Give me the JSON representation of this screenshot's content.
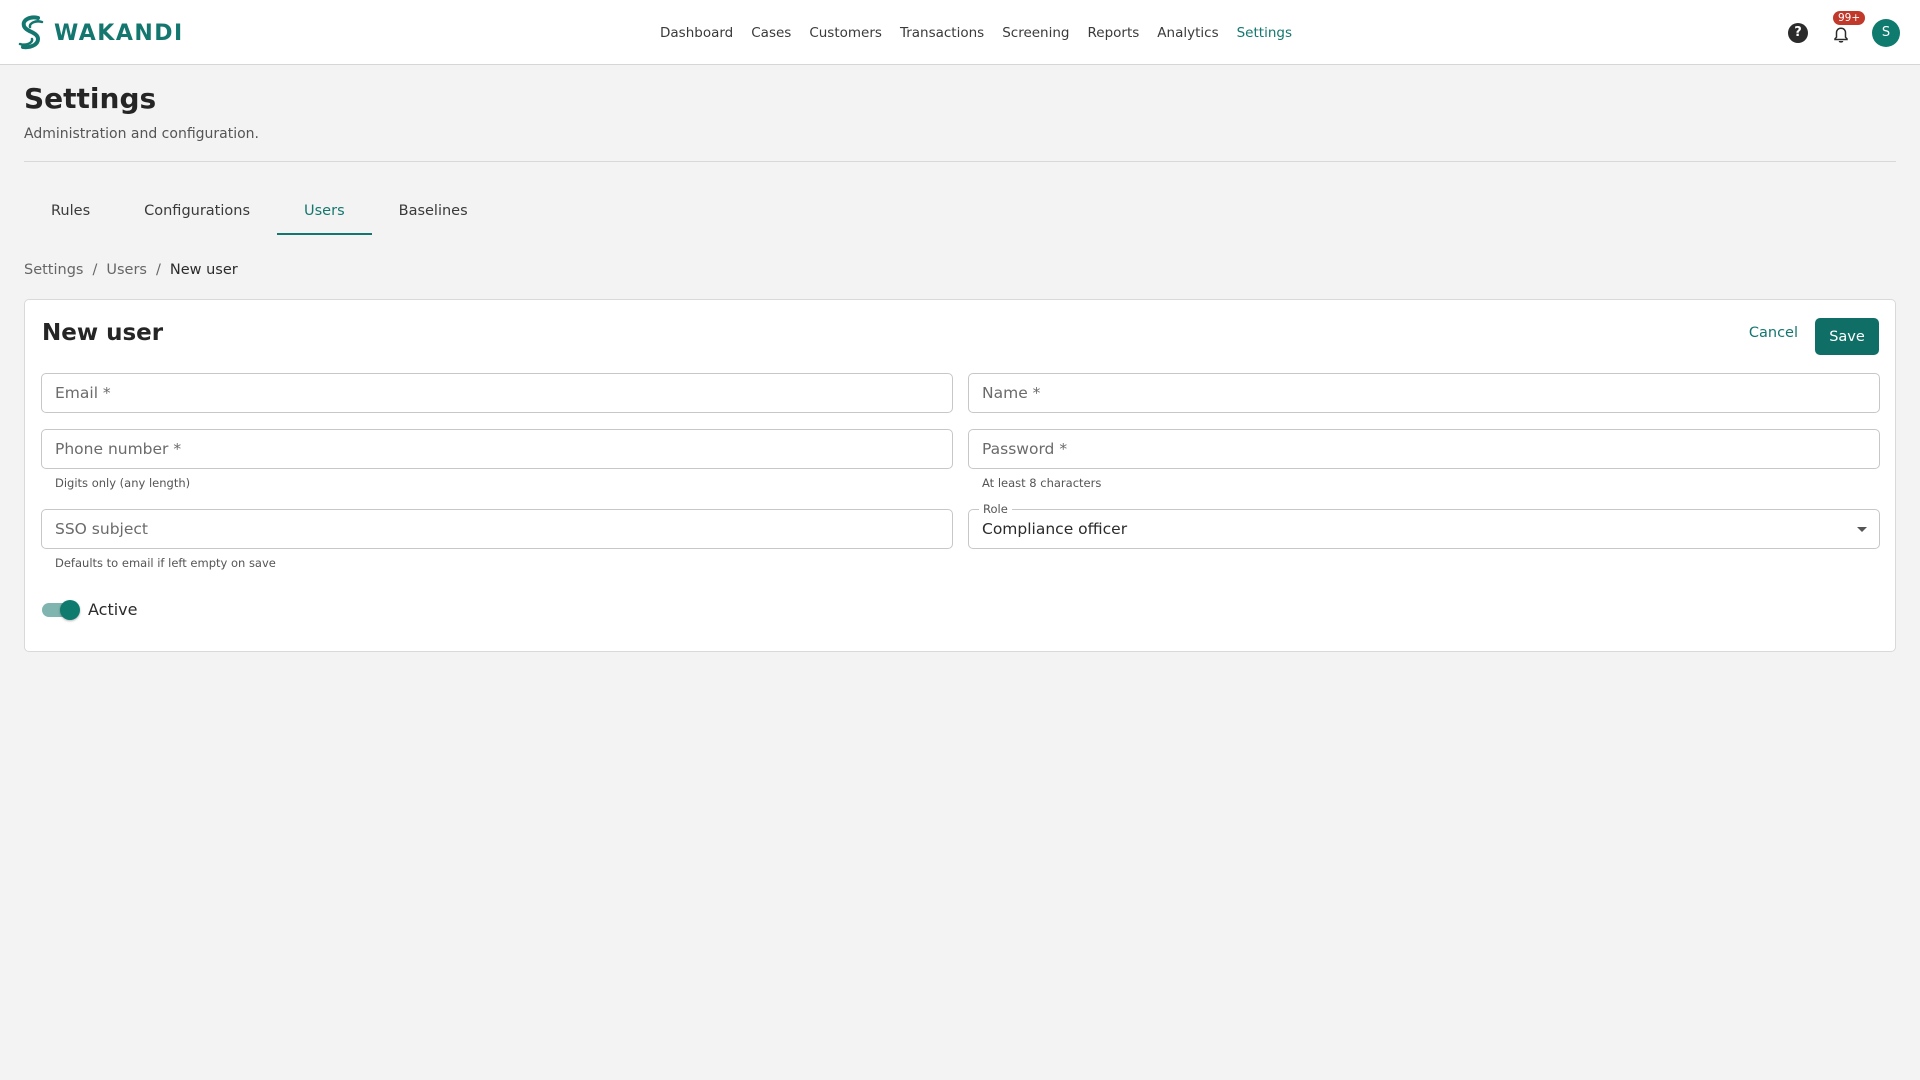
{
  "app": {
    "brand": "WAKANDI"
  },
  "nav": {
    "items": [
      {
        "label": "Dashboard"
      },
      {
        "label": "Cases"
      },
      {
        "label": "Customers"
      },
      {
        "label": "Transactions"
      },
      {
        "label": "Screening"
      },
      {
        "label": "Reports"
      },
      {
        "label": "Analytics"
      },
      {
        "label": "Settings",
        "active": true
      }
    ],
    "notifications_badge": "99+",
    "help_glyph": "?",
    "avatar_initial": "S"
  },
  "page": {
    "title": "Settings",
    "subtitle": "Administration and configuration."
  },
  "tabs": [
    {
      "label": "Rules"
    },
    {
      "label": "Configurations"
    },
    {
      "label": "Users",
      "active": true
    },
    {
      "label": "Baselines"
    }
  ],
  "breadcrumb": {
    "items": [
      "Settings",
      "Users"
    ],
    "separator": "/",
    "current": "New user"
  },
  "form": {
    "title": "New user",
    "cancel_label": "Cancel",
    "save_label": "Save",
    "email": {
      "placeholder": "Email *",
      "value": ""
    },
    "name": {
      "placeholder": "Name *",
      "value": ""
    },
    "phone": {
      "placeholder": "Phone number *",
      "value": "",
      "helper": "Digits only (any length)"
    },
    "password": {
      "placeholder": "Password *",
      "value": "",
      "helper": "At least 8 characters"
    },
    "sso": {
      "placeholder": "SSO subject",
      "value": "",
      "helper": "Defaults to email if left empty on save"
    },
    "role": {
      "label": "Role",
      "value": "Compliance officer"
    },
    "active": {
      "label": "Active",
      "checked": true
    }
  },
  "colors": {
    "accent": "#14776f",
    "button": "#0f6f66",
    "badge": "#c0392b"
  },
  "icons": {
    "logo": "wakandi-logo-icon",
    "help": "help-circle-icon",
    "notifications": "bell-icon",
    "dropdown": "chevron-down-icon"
  }
}
